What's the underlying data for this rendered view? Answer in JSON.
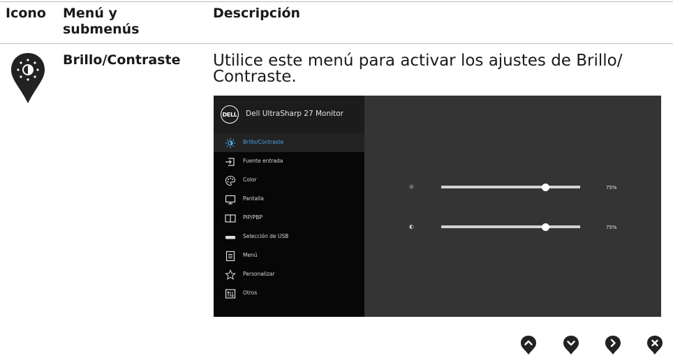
{
  "header": {
    "icon_col": "Icono",
    "menu_col": "Menú y submenús",
    "desc_col": "Descripción"
  },
  "row": {
    "title": "Brillo/Contraste",
    "description": "Utilice este menú para activar los ajustes de Brillo/ Contraste."
  },
  "osd": {
    "logo_text": "DELL",
    "title": "Dell UltraSharp 27 Monitor",
    "menu_items": [
      {
        "label": "Brillo/Contraste",
        "icon": "brightness-icon",
        "active": true
      },
      {
        "label": "Fuente entrada",
        "icon": "input-source-icon"
      },
      {
        "label": "Color",
        "icon": "color-palette-icon"
      },
      {
        "label": "Pantalla",
        "icon": "monitor-icon"
      },
      {
        "label": "PIP/PBP",
        "icon": "pip-icon"
      },
      {
        "label": "Selección de USB",
        "icon": "usb-icon"
      },
      {
        "label": "Menú",
        "icon": "menu-icon"
      },
      {
        "label": "Personalizar",
        "icon": "star-icon"
      },
      {
        "label": "Otros",
        "icon": "others-icon"
      }
    ],
    "brightness": {
      "label": "☼",
      "value": 0.75,
      "value_text": "75%"
    },
    "contrast": {
      "label": "◐",
      "value": 0.75,
      "value_text": "75%"
    }
  },
  "nav_buttons": [
    {
      "icon": "up-arrow-icon"
    },
    {
      "icon": "down-arrow-icon"
    },
    {
      "icon": "right-arrow-icon"
    },
    {
      "icon": "close-icon"
    }
  ],
  "colors": {
    "osd_bg": "#343434",
    "menu_bg": "#070707",
    "accent": "#4aa3e0"
  }
}
